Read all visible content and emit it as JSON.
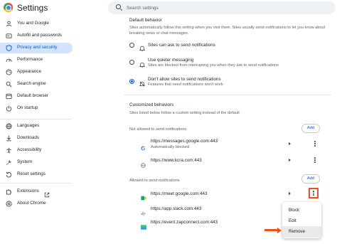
{
  "app": {
    "title": "Settings"
  },
  "search": {
    "placeholder": "Search settings"
  },
  "sidebar": {
    "items": [
      {
        "label": "You and Google",
        "icon": "person-icon"
      },
      {
        "label": "Autofill and passwords",
        "icon": "autofill-icon"
      },
      {
        "label": "Privacy and security",
        "icon": "shield-icon",
        "active": true
      },
      {
        "label": "Performance",
        "icon": "speedometer-icon"
      },
      {
        "label": "Appearance",
        "icon": "palette-icon"
      },
      {
        "label": "Search engine",
        "icon": "search-icon"
      },
      {
        "label": "Default browser",
        "icon": "browser-icon"
      },
      {
        "label": "On startup",
        "icon": "power-icon"
      },
      {
        "label": "Languages",
        "icon": "globe-icon"
      },
      {
        "label": "Downloads",
        "icon": "download-icon"
      },
      {
        "label": "Accessibility",
        "icon": "accessibility-icon"
      },
      {
        "label": "System",
        "icon": "wrench-icon"
      },
      {
        "label": "Reset settings",
        "icon": "reset-icon"
      },
      {
        "label": "Extensions",
        "icon": "puzzle-icon",
        "external_icon": "open-in-new-icon"
      },
      {
        "label": "About Chrome",
        "icon": "chrome-icon"
      }
    ]
  },
  "main": {
    "default_behavior": {
      "heading": "Default behavior",
      "description_line1": "Sites automatically follow this setting when you visit them. Sites usually send notifications to let you know about",
      "description_line2": "breaking news or chat messages.",
      "options": [
        {
          "label": "Sites can ask to send notifications",
          "icon": "bell-icon",
          "selected": false
        },
        {
          "label": "Use quieter messaging",
          "sub": "Sites are blocked from interrupting you when they ask to send notifications",
          "icon": "bell-quiet-icon",
          "selected": false
        },
        {
          "label": "Don't allow sites to send notifications",
          "sub": "Features that need notifications won't work",
          "icon": "bell-off-icon",
          "selected": true
        }
      ]
    },
    "customized": {
      "heading": "Customized behaviors",
      "description": "Sites listed below follow a custom setting instead of the default"
    },
    "not_allowed": {
      "heading": "Not allowed to send notifications",
      "add_label": "Add",
      "sites": [
        {
          "url": "https://messages.google.com:443",
          "note": "Automatically blocked",
          "icon": "google-favicon"
        },
        {
          "url": "https://www.kcra.com:443",
          "icon": "globe-favicon"
        }
      ]
    },
    "allowed": {
      "heading": "Allowed to send notifications",
      "add_label": "Add",
      "sites": [
        {
          "url": "https://meet.google.com:443",
          "icon": "meet-favicon"
        },
        {
          "url": "https://app.slack.com:443",
          "icon": "slack-favicon"
        },
        {
          "url": "https://event.zapconnect.com:443",
          "icon": "zapconnect-favicon"
        }
      ]
    },
    "context_menu": {
      "items": [
        {
          "label": "Block"
        },
        {
          "label": "Edit"
        },
        {
          "label": "Remove",
          "highlighted": true
        }
      ]
    }
  },
  "colors": {
    "accent": "#0b57d0",
    "active_nav_bg": "#d3e3fd",
    "callout": "#f0501e"
  }
}
